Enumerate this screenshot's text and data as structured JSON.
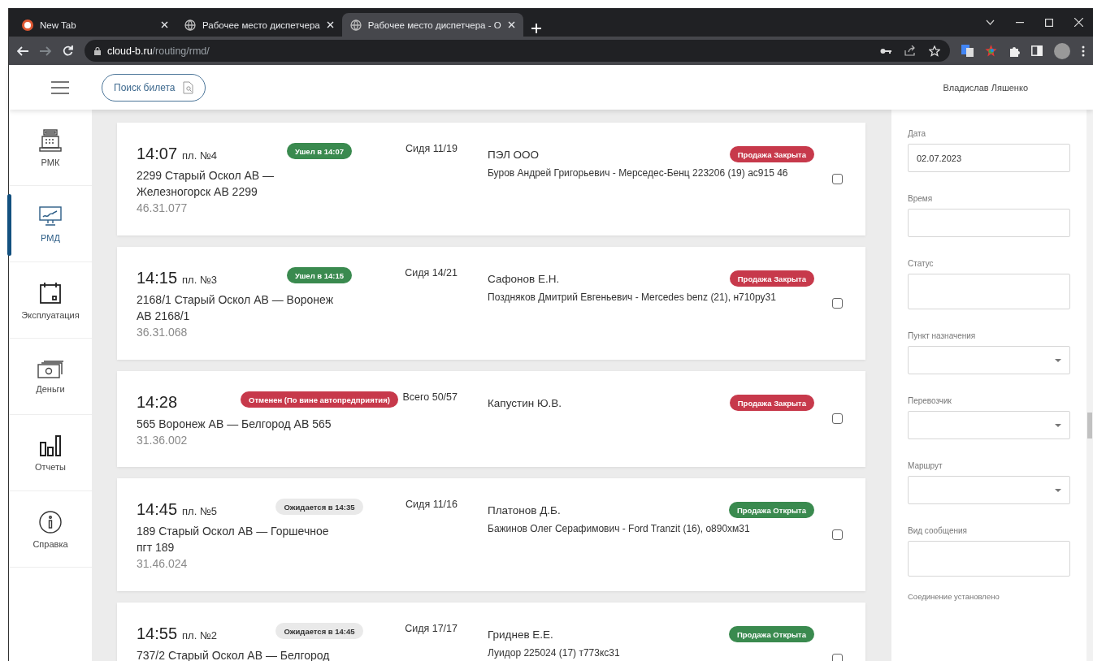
{
  "browser": {
    "tabs": [
      {
        "title": "New Tab",
        "selected": false
      },
      {
        "title": "Рабочее место диспетчера",
        "selected": false
      },
      {
        "title": "Рабочее место диспетчера - О",
        "selected": true
      }
    ],
    "url": {
      "domain": "cloud-b.ru",
      "path": "/routing/rmd/"
    }
  },
  "header": {
    "search_button": "Поиск билета",
    "user_name": "Владислав Ляшенко"
  },
  "sidebar": {
    "items": [
      {
        "label": "РМК",
        "selected": false
      },
      {
        "label": "РМД",
        "selected": true
      },
      {
        "label": "Эксплуатация",
        "selected": false
      },
      {
        "label": "Деньги",
        "selected": false
      },
      {
        "label": "Отчеты",
        "selected": false
      },
      {
        "label": "Справка",
        "selected": false
      }
    ]
  },
  "trips": [
    {
      "time": "14:07",
      "platform": "пл. №4",
      "status": {
        "text": "Ушел в 14:07",
        "kind": "departed"
      },
      "seats": "Сидя 11/19",
      "route": "2299 Старый Оскол АВ — Железногорск АВ 2299",
      "code": "46.31.077",
      "carrier": "ПЭЛ ООО",
      "driver": "Буров Андрей Григорьевич - Мерседес-Бенц 223206 (19) ас915 46",
      "sale": {
        "text": "Продажа Закрыта",
        "open": false
      },
      "checked": false
    },
    {
      "time": "14:15",
      "platform": "пл. №3",
      "status": {
        "text": "Ушел в 14:15",
        "kind": "departed"
      },
      "seats": "Сидя 14/21",
      "route": "2168/1 Старый Оскол АВ — Воронеж АВ 2168/1",
      "code": "36.31.068",
      "carrier": "Сафонов Е.Н.",
      "driver": "Поздняков Дмитрий Евгеньевич - Mercedes benz (21), н710ру31",
      "sale": {
        "text": "Продажа Закрыта",
        "open": false
      },
      "checked": false
    },
    {
      "time": "14:28",
      "status": {
        "text": "Отменен (По вине автопредприятия)",
        "kind": "cancelled"
      },
      "seats": "Всего 50/57",
      "route": "565 Воронеж АВ — Белгород АВ 565",
      "code": "31.36.002",
      "carrier": "Капустин Ю.В.",
      "sale": {
        "text": "Продажа Закрыта",
        "open": false
      },
      "checked": false
    },
    {
      "time": "14:45",
      "platform": "пл. №5",
      "status": {
        "text": "Ожидается в 14:35",
        "kind": "expected"
      },
      "seats": "Сидя 11/16",
      "route": "189 Старый Оскол АВ — Горшечное пгт 189",
      "code": "31.46.024",
      "carrier": "Платонов Д.Б.",
      "driver": "Бажинов Олег Серафимович - Ford Tranzit (16), о890хм31",
      "sale": {
        "text": "Продажа Открыта",
        "open": true
      },
      "checked": false
    },
    {
      "time": "14:55",
      "platform": "пл. №2",
      "status": {
        "text": "Ожидается в 14:45",
        "kind": "expected"
      },
      "seats": "Сидя 17/17",
      "route": "737/2 Старый Оскол АВ — Белгород",
      "carrier": "Гриднев Е.Е.",
      "driver": "Луидор 225024 (17) т773кс31",
      "sale": {
        "text": "Продажа Открыта",
        "open": true
      },
      "checked": false
    }
  ],
  "filters": [
    {
      "label": "Дата",
      "kind": "text",
      "value": "02.07.2023"
    },
    {
      "label": "Время",
      "kind": "text"
    },
    {
      "label": "Статус",
      "kind": "multi"
    },
    {
      "label": "Пункт назначения",
      "kind": "select"
    },
    {
      "label": "Перевозчик",
      "kind": "select"
    },
    {
      "label": "Маршрут",
      "kind": "select"
    },
    {
      "label": "Вид сообщения",
      "kind": "multi"
    }
  ],
  "connection_status": "Соединение установлено"
}
